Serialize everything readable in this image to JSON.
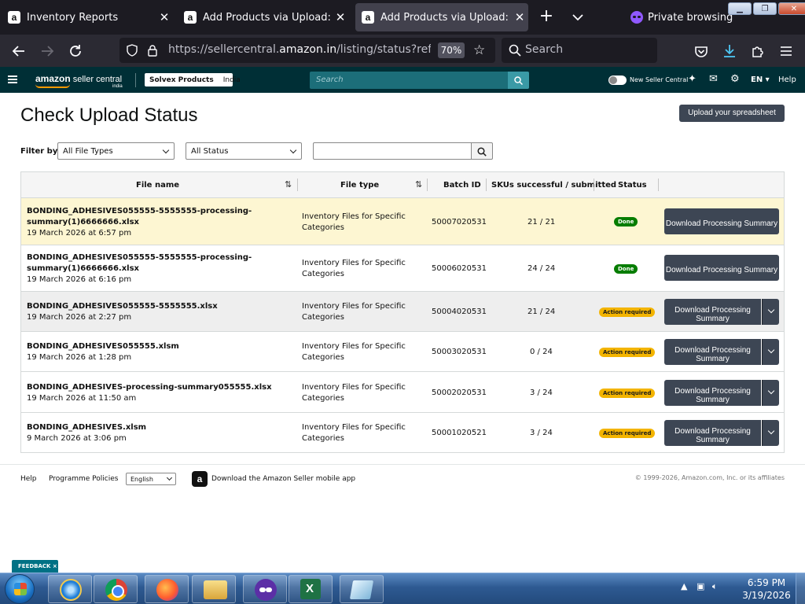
{
  "browser": {
    "tabs": [
      {
        "title": "Inventory Reports",
        "favicon": "a",
        "active": false
      },
      {
        "title": "Add Products via Upload: Upload",
        "favicon": "a",
        "active": false
      },
      {
        "title": "Add Products via Upload: Check",
        "favicon": "a",
        "active": true
      }
    ],
    "private_label": "Private browsing",
    "url_prefix": "https://sellercentral.",
    "url_domain": "amazon.in",
    "url_suffix": "/listing/status?reference_",
    "zoom": "70%",
    "search_placeholder": "Search"
  },
  "seller_header": {
    "logo_main": "amazon",
    "logo_sub": " seller central",
    "logo_region": "india",
    "account_name": "Solvex Products",
    "account_region": "India",
    "search_placeholder": "Search",
    "toggle_label": "New Seller Central",
    "language": "EN ▾",
    "help": "Help"
  },
  "page": {
    "title": "Check Upload Status",
    "upload_button": "Upload your spreadsheet",
    "filter_label": "Filter by:",
    "file_type_select": "All File Types",
    "status_select": "All Status"
  },
  "table": {
    "headers": {
      "file_name": "File name",
      "file_type": "File type",
      "batch_id": "Batch ID",
      "skus": "SKUs successful / submitted",
      "status": "Status"
    },
    "download_label": "Download Processing Summary",
    "rows": [
      {
        "file_name": "BONDING_ADHESIVES055555-5555555-processing-summary(1)6666666.xlsx",
        "date": "19 March 2026 at 6:57 pm",
        "file_type": "Inventory Files for Specific Categories",
        "batch_id": "50007020531",
        "skus": "21 / 21",
        "status": "Done"
      },
      {
        "file_name": "BONDING_ADHESIVES055555-5555555-processing-summary(1)6666666.xlsx",
        "date": "19 March 2026 at 6:16 pm",
        "file_type": "Inventory Files for Specific Categories",
        "batch_id": "50006020531",
        "skus": "24 / 24",
        "status": "Done"
      },
      {
        "file_name": "BONDING_ADHESIVES055555-5555555.xlsx",
        "date": "19 March 2026 at 2:27 pm",
        "file_type": "Inventory Files for Specific Categories",
        "batch_id": "50004020531",
        "skus": "21 / 24",
        "status": "Action required"
      },
      {
        "file_name": "BONDING_ADHESIVES055555.xlsm",
        "date": "19 March 2026 at 1:28 pm",
        "file_type": "Inventory Files for Specific Categories",
        "batch_id": "50003020531",
        "skus": "0 / 24",
        "status": "Action required"
      },
      {
        "file_name": "BONDING_ADHESIVES-processing-summary055555.xlsx",
        "date": "19 March 2026 at 11:50 am",
        "file_type": "Inventory Files for Specific Categories",
        "batch_id": "50002020531",
        "skus": "3 / 24",
        "status": "Action required"
      },
      {
        "file_name": "BONDING_ADHESIVES.xlsm",
        "date": "9 March 2026 at 3:06 pm",
        "file_type": "Inventory Files for Specific Categories",
        "batch_id": "50001020521",
        "skus": "3 / 24",
        "status": "Action required"
      }
    ]
  },
  "footer": {
    "help": "Help",
    "policies": "Programme Policies",
    "language": "English",
    "app_text": "Download the Amazon Seller mobile app",
    "copyright": "© 1999-2026, Amazon.com, Inc. or its affiliates"
  },
  "feedback": {
    "label": "FEEDBACK ×"
  },
  "taskbar": {
    "time": "6:59 PM",
    "date": "3/19/2026"
  },
  "colors": {
    "header_bg": "#002f36",
    "button_dark": "#3d4654",
    "done_green": "#067d00",
    "action_yellow": "#f3b400",
    "highlight_row": "#fdf6d2"
  }
}
